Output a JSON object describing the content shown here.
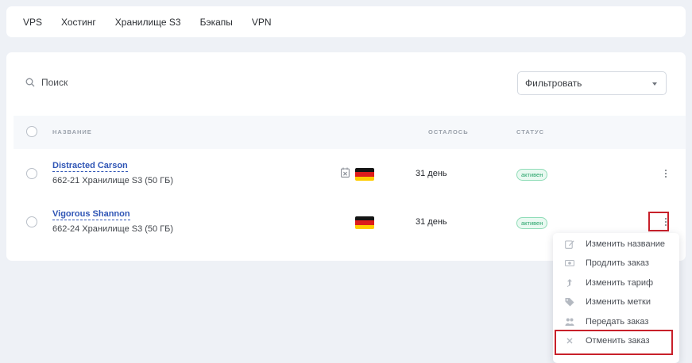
{
  "nav": {
    "tabs": [
      "VPS",
      "Хостинг",
      "Хранилище S3",
      "Бэкапы",
      "VPN"
    ]
  },
  "search": {
    "placeholder": "Поиск"
  },
  "filter": {
    "label": "Фильтровать"
  },
  "table": {
    "columns": {
      "name": "НАЗВАНИЕ",
      "left": "ОСТАЛОСЬ",
      "status": "СТАТУС"
    },
    "rows": [
      {
        "name": "Distracted Carson",
        "sub": "662-21  Хранилище S3 (50 ГБ)",
        "left": "31 день",
        "status": "активен",
        "has_calendar": true,
        "flag": "germany-flag"
      },
      {
        "name": "Vigorous Shannon",
        "sub": "662-24  Хранилище S3 (50 ГБ)",
        "left": "31 день",
        "status": "активен",
        "has_calendar": false,
        "flag": "germany-flag"
      }
    ]
  },
  "context_menu": {
    "items": [
      {
        "label": "Изменить название",
        "icon": "edit-icon"
      },
      {
        "label": "Продлить заказ",
        "icon": "money-icon"
      },
      {
        "label": "Изменить тариф",
        "icon": "arrow-up-icon"
      },
      {
        "label": "Изменить метки",
        "icon": "tags-icon"
      },
      {
        "label": "Передать заказ",
        "icon": "users-icon"
      },
      {
        "label": "Отменить заказ",
        "icon": "close-icon"
      }
    ]
  },
  "colors": {
    "link": "#2f55b5",
    "active_green": "#27a36a",
    "highlight": "#c8202a",
    "background": "#eef1f6"
  }
}
